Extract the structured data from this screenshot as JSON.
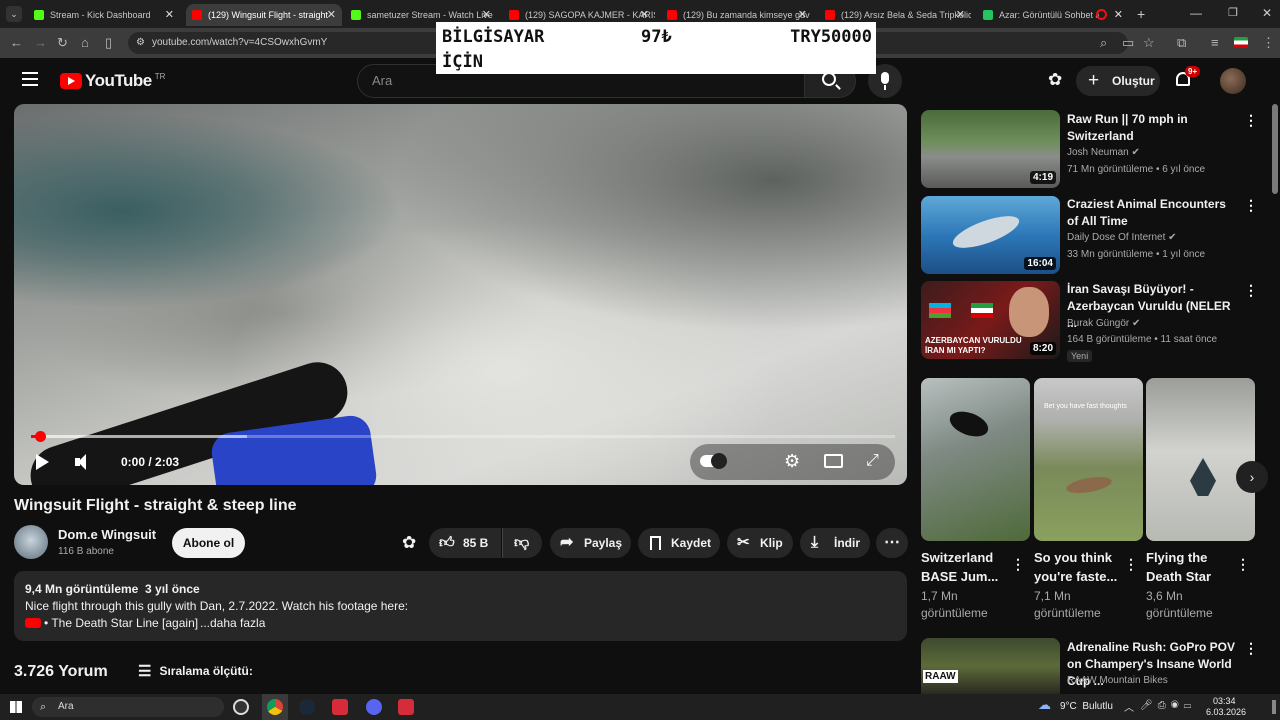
{
  "tabs": [
    {
      "label": "Stream - Kick Dashboard",
      "color": "#53fc18"
    },
    {
      "label": "(129) Wingsuit Flight - straight",
      "color": "#ff0000"
    },
    {
      "label": "sametuzer Stream - Watch Live",
      "color": "#53fc18"
    },
    {
      "label": "(129) SAGOPA KAJMER - KARIŞ",
      "color": "#ff0000"
    },
    {
      "label": "(129) Bu zamanda kimseye güv",
      "color": "#ff0000"
    },
    {
      "label": "(129) Arsız Bela & Seda Tripkolic",
      "color": "#ff0000"
    },
    {
      "label": "Azar: Görüntülü Sohbet &",
      "color": "#22c55e"
    }
  ],
  "browser": {
    "url": "youtube.com/watch?v=4CSOwxhGvmY"
  },
  "overlay": {
    "line1_left": "BİLGİSAYAR",
    "line1_mid": "97₺",
    "line1_right": "TRY50000",
    "line2": "İÇİN"
  },
  "header": {
    "logo": "YouTube",
    "country": "TR",
    "search_placeholder": "Ara",
    "create_label": "Oluştur",
    "notif_count": "9+"
  },
  "player": {
    "time": "0:00 / 2:03",
    "progress": 0.01,
    "buffered": 0.25
  },
  "video": {
    "title": "Wingsuit Flight - straight & steep line",
    "channel": "Dom.e Wingsuit",
    "subscribers": "116 B abone",
    "subscribe_label": "Abone ol",
    "likes": "85 B",
    "share_label": "Paylaş",
    "save_label": "Kaydet",
    "clip_label": "Klip",
    "download_label": "İndir"
  },
  "description": {
    "stats": "9,4 Mn görüntüleme  3 yıl önce",
    "text": "Nice flight through this gully with Dan, 2.7.2022. Watch his footage here:",
    "link": "• The Death Star Line [again]",
    "more": "...daha fazla"
  },
  "comments": {
    "count": "3.726 Yorum",
    "sort_label": "Sıralama ölçütü:"
  },
  "sidebar": [
    {
      "title": "Raw Run || 70 mph in Switzerland",
      "channel": "Josh Neuman",
      "meta": "71 Mn görüntüleme • 6 yıl önce",
      "duration": "4:19",
      "badge": ""
    },
    {
      "title": "Craziest Animal Encounters of All Time",
      "channel": "Daily Dose Of Internet",
      "meta": "33 Mn görüntüleme • 1 yıl önce",
      "duration": "16:04",
      "badge": ""
    },
    {
      "title": "İran Savaşı Büyüyor! - Azerbaycan Vuruldu (NELER ...",
      "channel": "Burak Güngör",
      "meta": "164 B görüntüleme • 11 saat önce",
      "duration": "8:20",
      "badge": "Yeni",
      "thumb_text": "AZERBAYCAN VURULDU İRAN MI YAPTI?"
    },
    {
      "title": "Adrenaline Rush: GoPro POV on Champery's Insane World Cup ...",
      "channel": "RAAW Mountain Bikes",
      "meta": "",
      "duration": "",
      "badge": "",
      "thumb_text": "RAAW"
    }
  ],
  "shorts": [
    {
      "title": "Switzerland BASE Jum...",
      "views": "1,7 Mn görüntüleme"
    },
    {
      "title": "So you think you're faste...",
      "views": "7,1 Mn görüntüleme",
      "thumb_text": "Bet you have fast thoughts"
    },
    {
      "title": "Flying the Death Star",
      "views": "3,6 Mn görüntüleme"
    }
  ],
  "taskbar": {
    "search": "Ara",
    "weather": "9°C  Bulutlu",
    "time": "03:34",
    "date": "6.03.2026"
  }
}
